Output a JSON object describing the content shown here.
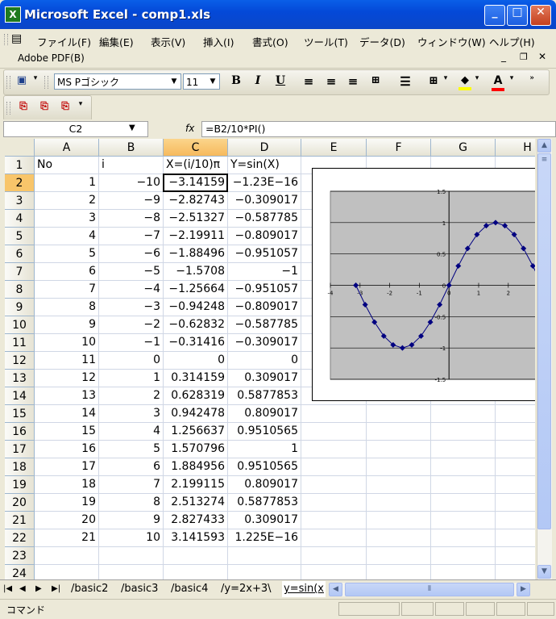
{
  "window": {
    "title": "Microsoft Excel - comp1.xls",
    "app_icon": "excel-icon",
    "buttons": [
      "minimize",
      "maximize",
      "close"
    ]
  },
  "menu": {
    "items": [
      "ファイル(F)",
      "編集(E)",
      "表示(V)",
      "挿入(I)",
      "書式(O)",
      "ツール(T)",
      "データ(D)",
      "ウィンドウ(W)",
      "ヘルプ(H)"
    ],
    "second_row": "Adobe PDF(B)"
  },
  "toolbar": {
    "font_name": "MS Pゴシック",
    "font_size": "11",
    "bold": "B",
    "italic": "I",
    "underline": "U",
    "font_color_letter": "A",
    "fill_color": "#ffff00",
    "font_color": "#ff0000"
  },
  "formula_bar": {
    "name_box": "C2",
    "fx": "fx",
    "formula": "=B2/10*PI()"
  },
  "sheet": {
    "columns": [
      "A",
      "B",
      "C",
      "D",
      "E",
      "F",
      "G",
      "H"
    ],
    "selected_column": "C",
    "selected_row": "2",
    "rows": [
      "1",
      "2",
      "3",
      "4",
      "5",
      "6",
      "7",
      "8",
      "9",
      "10",
      "11",
      "12",
      "13",
      "14",
      "15",
      "16",
      "17",
      "18",
      "19",
      "20",
      "21",
      "22",
      "23",
      "24"
    ],
    "header_row": [
      "No",
      "i",
      "X=(i/10)π",
      "Y=sin(X)"
    ],
    "data": [
      [
        "1",
        "−10",
        "−3.14159",
        "−1.23E−16"
      ],
      [
        "2",
        "−9",
        "−2.82743",
        "−0.309017"
      ],
      [
        "3",
        "−8",
        "−2.51327",
        "−0.587785"
      ],
      [
        "4",
        "−7",
        "−2.19911",
        "−0.809017"
      ],
      [
        "5",
        "−6",
        "−1.88496",
        "−0.951057"
      ],
      [
        "6",
        "−5",
        "−1.5708",
        "−1"
      ],
      [
        "7",
        "−4",
        "−1.25664",
        "−0.951057"
      ],
      [
        "8",
        "−3",
        "−0.94248",
        "−0.809017"
      ],
      [
        "9",
        "−2",
        "−0.62832",
        "−0.587785"
      ],
      [
        "10",
        "−1",
        "−0.31416",
        "−0.309017"
      ],
      [
        "11",
        "0",
        "0",
        "0"
      ],
      [
        "12",
        "1",
        "0.314159",
        "0.309017"
      ],
      [
        "13",
        "2",
        "0.628319",
        "0.5877853"
      ],
      [
        "14",
        "3",
        "0.942478",
        "0.809017"
      ],
      [
        "15",
        "4",
        "1.256637",
        "0.9510565"
      ],
      [
        "16",
        "5",
        "1.570796",
        "1"
      ],
      [
        "17",
        "6",
        "1.884956",
        "0.9510565"
      ],
      [
        "18",
        "7",
        "2.199115",
        "0.809017"
      ],
      [
        "19",
        "8",
        "2.513274",
        "0.5877853"
      ],
      [
        "20",
        "9",
        "2.827433",
        "0.309017"
      ],
      [
        "21",
        "10",
        "3.141593",
        "1.225E−16"
      ]
    ]
  },
  "chart_data": {
    "type": "scatter",
    "title": "",
    "xlabel": "",
    "ylabel": "",
    "xlim": [
      -4,
      4
    ],
    "ylim": [
      -1.5,
      1.5
    ],
    "x_ticks": [
      "-4",
      "-3",
      "-2",
      "-1",
      "0",
      "1",
      "2"
    ],
    "y_ticks": [
      "1.5",
      "1",
      "0.5",
      "0",
      "-0.5",
      "-1",
      "-1.5"
    ],
    "grid": true,
    "plot_area_color": "#c0c0c0",
    "series_color": "#000080",
    "series": [
      {
        "x": [
          -3.14159,
          -2.82743,
          -2.51327,
          -2.19911,
          -1.88496,
          -1.5708,
          -1.25664,
          -0.94248,
          -0.62832,
          -0.31416,
          0,
          0.314159,
          0.628319,
          0.942478,
          1.256637,
          1.570796,
          1.884956,
          2.199115,
          2.513274,
          2.827433,
          3.141593
        ],
        "y": [
          0,
          -0.309017,
          -0.587785,
          -0.809017,
          -0.951057,
          -1,
          -0.951057,
          -0.809017,
          -0.587785,
          -0.309017,
          0,
          0.309017,
          0.5877853,
          0.809017,
          0.9510565,
          1,
          0.9510565,
          0.809017,
          0.5877853,
          0.309017,
          0
        ]
      }
    ]
  },
  "tabs": {
    "items": [
      "basic2",
      "basic3",
      "basic4",
      "y=2x+3",
      "y=sin(x"
    ],
    "active": "y=sin(x"
  },
  "status": {
    "text": "コマンド"
  }
}
